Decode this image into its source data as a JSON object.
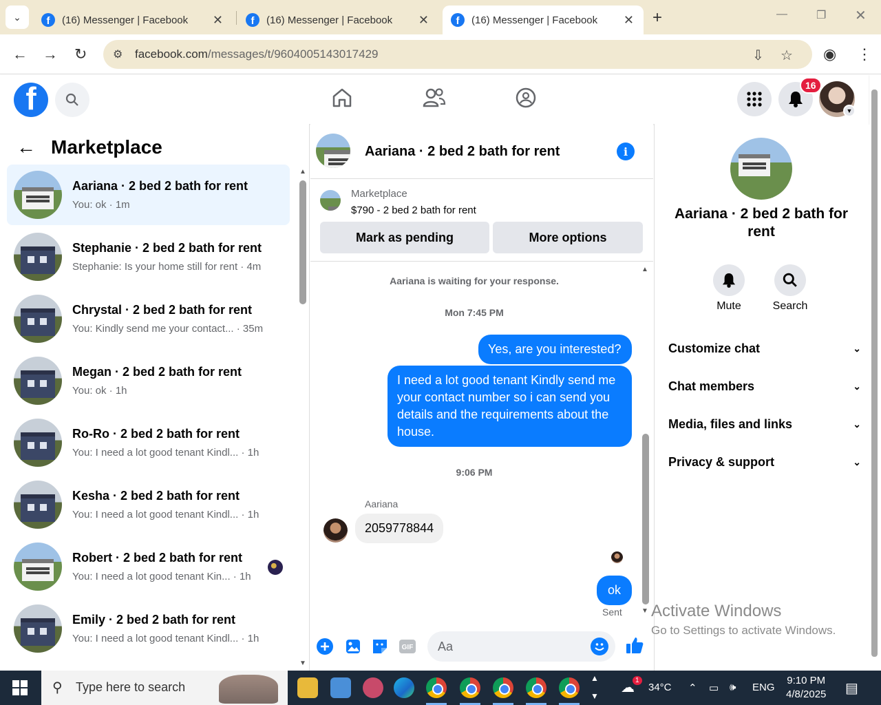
{
  "browser": {
    "tabs": [
      {
        "title": "(16) Messenger | Facebook"
      },
      {
        "title": "(16) Messenger | Facebook"
      },
      {
        "title": "(16) Messenger | Facebook"
      }
    ],
    "url_domain": "facebook.com",
    "url_path": "/messages/t/9604005143017429"
  },
  "header": {
    "notification_count": "16",
    "icons": [
      "home-icon",
      "friends-icon",
      "groups-icon",
      "menu-grid-icon",
      "bell-icon"
    ]
  },
  "left_panel": {
    "back_label": "←",
    "title": "Marketplace",
    "conversations": [
      {
        "name": "Aariana · 2 bed 2 bath for rent",
        "preview": "You: ok · 1m",
        "active": true
      },
      {
        "name": "Stephanie · 2 bed 2 bath for rent",
        "preview": "Stephanie: Is your home still for rent · 4m"
      },
      {
        "name": "Chrystal · 2 bed 2 bath for rent",
        "preview": "You: Kindly send me your contact...  · 35m"
      },
      {
        "name": "Megan · 2 bed 2 bath for rent",
        "preview": "You: ok · 1h"
      },
      {
        "name": "Ro-Ro · 2 bed 2 bath for rent",
        "preview": "You: I need a lot good tenant Kindl...  · 1h"
      },
      {
        "name": "Kesha · 2 bed 2 bath for rent",
        "preview": "You: I need a lot good tenant Kindl...  · 1h"
      },
      {
        "name": "Robert · 2 bed 2 bath for rent",
        "preview": "You: I need a lot good tenant Kin... · 1h"
      },
      {
        "name": "Emily · 2 bed 2 bath for rent",
        "preview": "You: I need a lot good tenant Kindl...  · 1h"
      }
    ]
  },
  "chat": {
    "title": "Aariana · 2 bed 2 bath for rent",
    "marketplace_label": "Marketplace",
    "listing": "$790 - 2 bed 2 bath for rent",
    "mark_pending": "Mark as pending",
    "more_options": "More options",
    "waiting_note": "Aariana is waiting for your response.",
    "time1": "Mon 7:45 PM",
    "msg1": "Yes, are you interested?",
    "msg2": "I need a lot good tenant Kindly send me your contact number so i can send you details and the requirements about the house.",
    "time2": "9:06 PM",
    "sender": "Aariana",
    "msg3": "2059778844",
    "msg4": "ok",
    "sent_label": "Sent",
    "input_placeholder": "Aa",
    "composer_gif": "GIF"
  },
  "right_panel": {
    "name": "Aariana · 2 bed 2 bath for rent",
    "mute": "Mute",
    "search": "Search",
    "sections": [
      "Customize chat",
      "Chat members",
      "Media, files and links",
      "Privacy & support"
    ]
  },
  "watermark": {
    "line1": "Activate Windows",
    "line2": "Go to Settings to activate Windows."
  },
  "taskbar": {
    "search_placeholder": "Type here to search",
    "weather_badge": "1",
    "temperature": "34°C",
    "language": "ENG",
    "time": "9:10 PM",
    "date": "4/8/2025"
  },
  "colors": {
    "accent": "#0a7cff",
    "fb_blue": "#1877f2",
    "active_row": "#ebf5ff"
  }
}
